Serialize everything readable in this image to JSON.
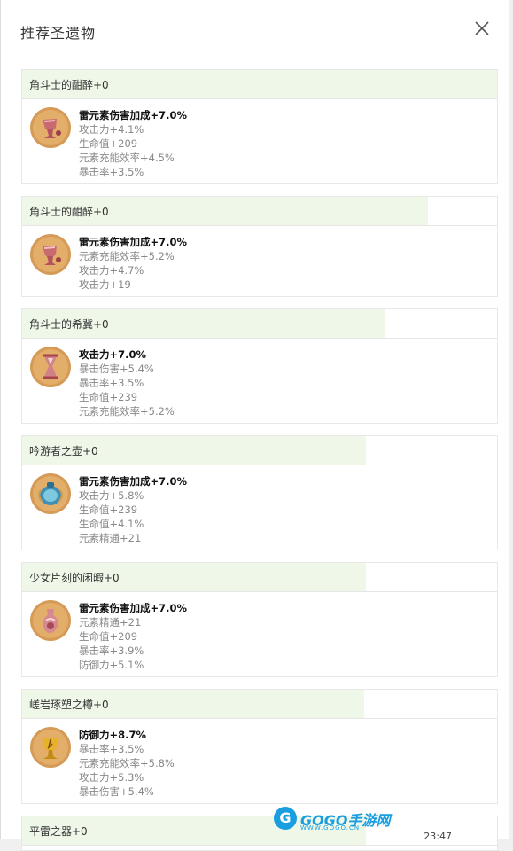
{
  "dialog": {
    "title": "推荐圣遗物"
  },
  "artifacts": [
    {
      "name": "角斗士的酣醉+0",
      "name_fill": 1.0,
      "main": "雷元素伤害加成+7.0%",
      "subs": [
        "攻击力+4.1%",
        "生命值+209",
        "元素充能效率+4.5%",
        "暴击率+3.5%"
      ],
      "icon": "goblet-icon"
    },
    {
      "name": "角斗士的酣醉+0",
      "name_fill": 0.85,
      "main": "雷元素伤害加成+7.0%",
      "subs": [
        "元素充能效率+5.2%",
        "攻击力+4.7%",
        "攻击力+19"
      ],
      "icon": "goblet-icon"
    },
    {
      "name": "角斗士的希冀+0",
      "name_fill": 0.76,
      "main": "攻击力+7.0%",
      "subs": [
        "暴击伤害+5.4%",
        "暴击率+3.5%",
        "生命值+239",
        "元素充能效率+5.2%"
      ],
      "icon": "hourglass-icon"
    },
    {
      "name": "吟游者之壶+0",
      "name_fill": 0.72,
      "main": "雷元素伤害加成+7.0%",
      "subs": [
        "攻击力+5.8%",
        "生命值+239",
        "生命值+4.1%",
        "元素精通+21"
      ],
      "icon": "blue-pot-icon"
    },
    {
      "name": "少女片刻的闲暇+0",
      "name_fill": 0.72,
      "main": "雷元素伤害加成+7.0%",
      "subs": [
        "元素精通+21",
        "生命值+209",
        "暴击率+3.9%",
        "防御力+5.1%"
      ],
      "icon": "vial-icon"
    },
    {
      "name": "嵯岩琢塑之樽+0",
      "name_fill": 0.72,
      "main": "防御力+8.7%",
      "subs": [
        "暴击率+3.5%",
        "元素充能效率+5.8%",
        "攻击力+5.3%",
        "暴击伤害+5.4%"
      ],
      "icon": "gold-goblet-icon"
    },
    {
      "name": "平雷之器+0",
      "name_fill": 0.72,
      "main": "",
      "subs": [],
      "icon": ""
    }
  ],
  "watermark": {
    "logo_letter": "G",
    "text": "GOGO手游网",
    "sub": "WWW.GOGO.CN"
  },
  "corner_time": "23:47"
}
